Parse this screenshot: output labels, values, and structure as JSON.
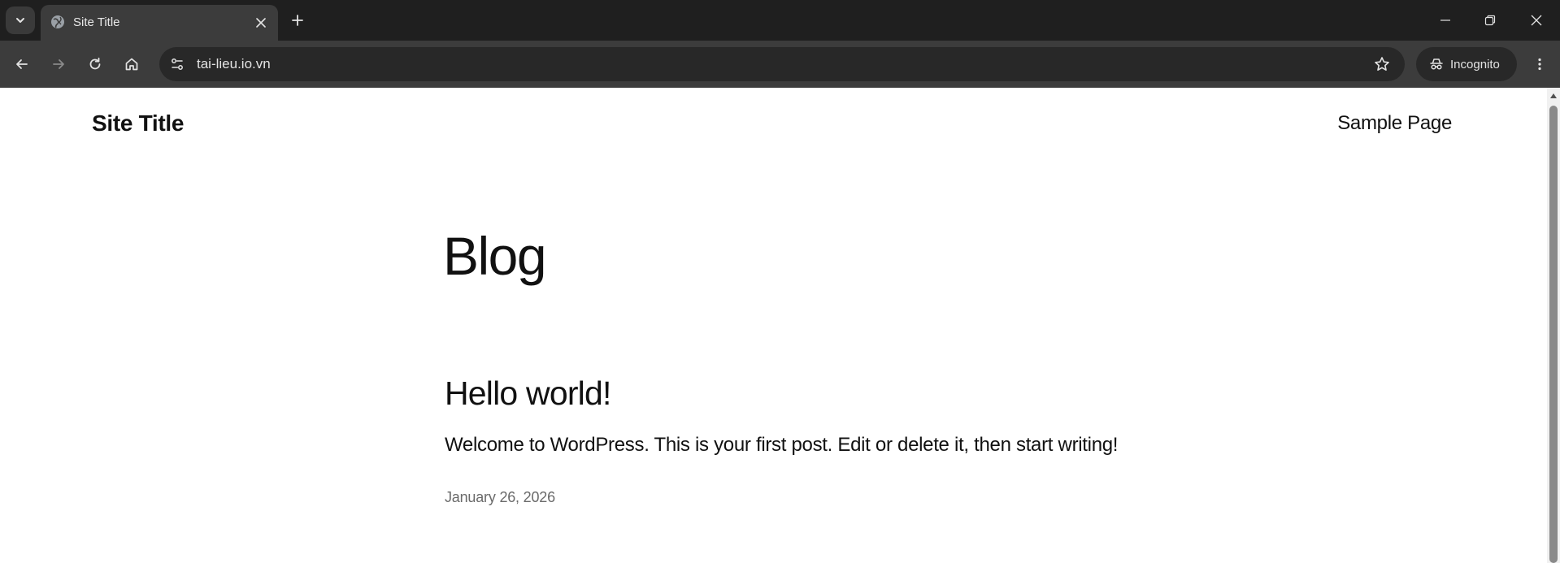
{
  "browser": {
    "tab": {
      "title": "Site Title"
    },
    "address_bar": {
      "url": "tai-lieu.io.vn"
    },
    "incognito_label": "Incognito",
    "colors": {
      "frame": "#1f1f1f",
      "toolbar": "#3c3c3c",
      "omnibox": "#282828"
    }
  },
  "site": {
    "title": "Site Title",
    "nav": {
      "items": [
        "Sample Page"
      ]
    }
  },
  "page": {
    "heading": "Blog",
    "posts": [
      {
        "title": "Hello world!",
        "excerpt": "Welcome to WordPress. This is your first post. Edit or delete it, then start writing!",
        "date": "January 26, 2026"
      }
    ]
  },
  "icons": {
    "tab_search": "chevron-down-icon",
    "favicon": "globe-icon",
    "tab_close": "close-icon",
    "new_tab": "plus-icon",
    "minimize": "minimize-icon",
    "restore": "restore-icon",
    "close_window": "close-icon",
    "back": "arrow-left-icon",
    "forward": "arrow-right-icon",
    "reload": "reload-icon",
    "home": "home-icon",
    "site_info": "tune-icon",
    "bookmark": "star-icon",
    "incognito": "incognito-icon",
    "menu": "kebab-menu-icon"
  }
}
